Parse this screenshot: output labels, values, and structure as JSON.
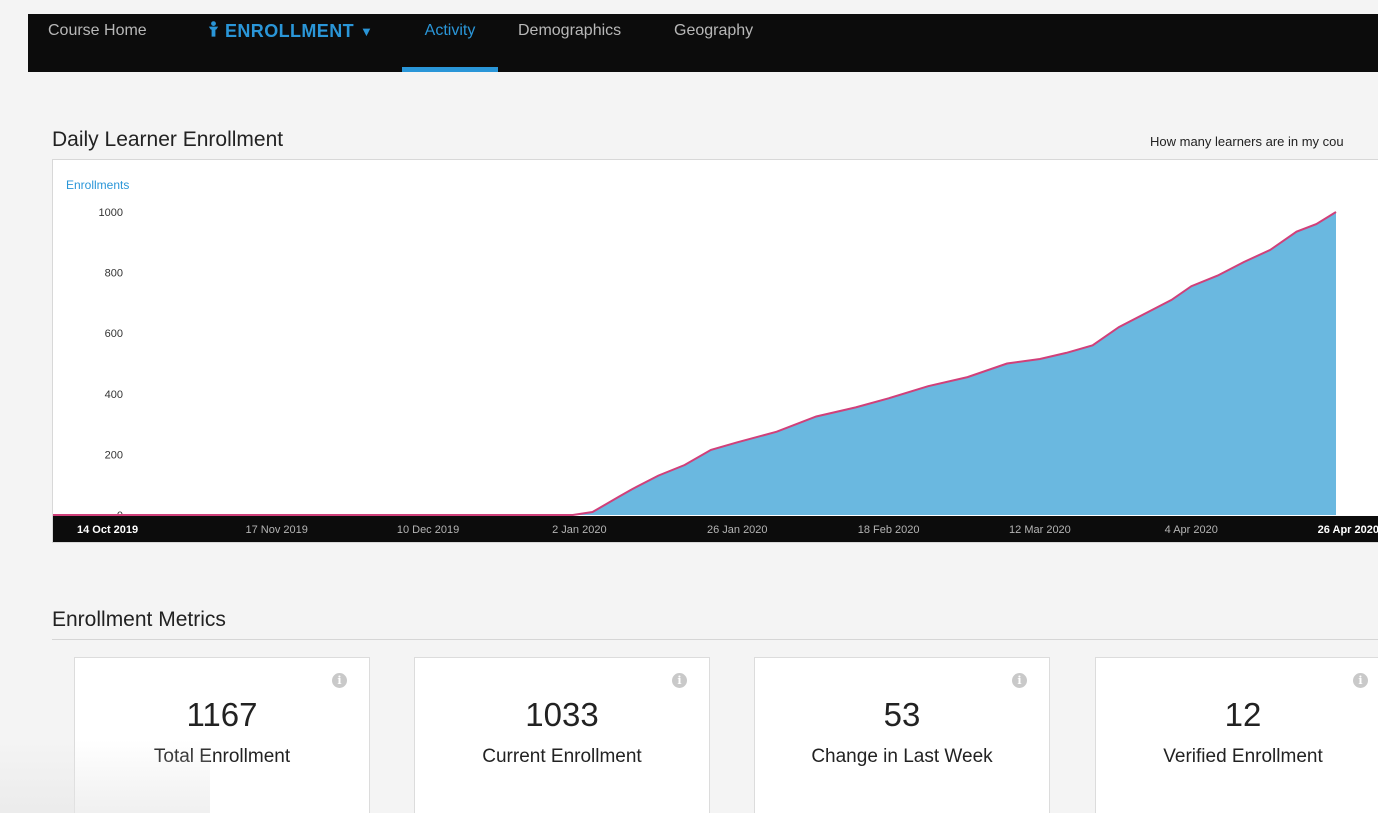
{
  "nav": {
    "home": "Course Home",
    "enrollment": "ENROLLMENT",
    "tabs": [
      {
        "label": "Activity",
        "active": true
      },
      {
        "label": "Demographics",
        "active": false
      },
      {
        "label": "Geography",
        "active": false
      }
    ],
    "accent_color": "#2a96d8"
  },
  "chart_section": {
    "title": "Daily Learner Enrollment",
    "help_text": "How many learners are in my cou"
  },
  "chart_data": {
    "type": "area",
    "title": "Daily Learner Enrollment",
    "series": [
      {
        "name": "Enrollments",
        "color": "#6ab8e0",
        "line_color": "#d0407a",
        "x": [
          "2019-10-14",
          "2019-12-20",
          "2019-12-27",
          "2020-01-01",
          "2020-01-04",
          "2020-01-06",
          "2020-01-08",
          "2020-01-10",
          "2020-01-14",
          "2020-01-18",
          "2020-01-22",
          "2020-01-26",
          "2020-02-01",
          "2020-02-07",
          "2020-02-13",
          "2020-02-18",
          "2020-02-24",
          "2020-03-01",
          "2020-03-07",
          "2020-03-12",
          "2020-03-16",
          "2020-03-20",
          "2020-03-24",
          "2020-03-28",
          "2020-04-01",
          "2020-04-04",
          "2020-04-08",
          "2020-04-12",
          "2020-04-16",
          "2020-04-20",
          "2020-04-23",
          "2020-04-26"
        ],
        "values": [
          0,
          0,
          0,
          0,
          10,
          35,
          60,
          85,
          130,
          165,
          215,
          240,
          275,
          325,
          355,
          385,
          425,
          455,
          500,
          515,
          535,
          560,
          620,
          665,
          710,
          755,
          790,
          835,
          875,
          935,
          960,
          1000
        ]
      }
    ],
    "ylabel": "Enrollments",
    "yticks": [
      0,
      200,
      400,
      600,
      800,
      1000
    ],
    "ylim": [
      0,
      1000
    ],
    "xlim": [
      "2019-10-14",
      "2020-04-26"
    ],
    "xticks": [
      {
        "label": "14 Oct 2019",
        "date": "2019-10-14",
        "bold": true
      },
      {
        "label": "17 Nov 2019",
        "date": "2019-11-17",
        "bold": false
      },
      {
        "label": "10 Dec 2019",
        "date": "2019-12-10",
        "bold": false
      },
      {
        "label": "2 Jan 2020",
        "date": "2020-01-02",
        "bold": false
      },
      {
        "label": "26 Jan 2020",
        "date": "2020-01-26",
        "bold": false
      },
      {
        "label": "18 Feb 2020",
        "date": "2020-02-18",
        "bold": false
      },
      {
        "label": "12 Mar 2020",
        "date": "2020-03-12",
        "bold": false
      },
      {
        "label": "4 Apr 2020",
        "date": "2020-04-04",
        "bold": false
      },
      {
        "label": "26 Apr 2020",
        "date": "2020-04-26",
        "bold": true
      }
    ],
    "grid": false,
    "legend": "none"
  },
  "metrics": {
    "title": "Enrollment Metrics",
    "cards": [
      {
        "value": "1167",
        "label": "Total Enrollment"
      },
      {
        "value": "1033",
        "label": "Current Enrollment"
      },
      {
        "value": "53",
        "label": "Change in Last Week"
      },
      {
        "value": "12",
        "label": "Verified Enrollment"
      }
    ],
    "info_icon": "info-icon"
  }
}
